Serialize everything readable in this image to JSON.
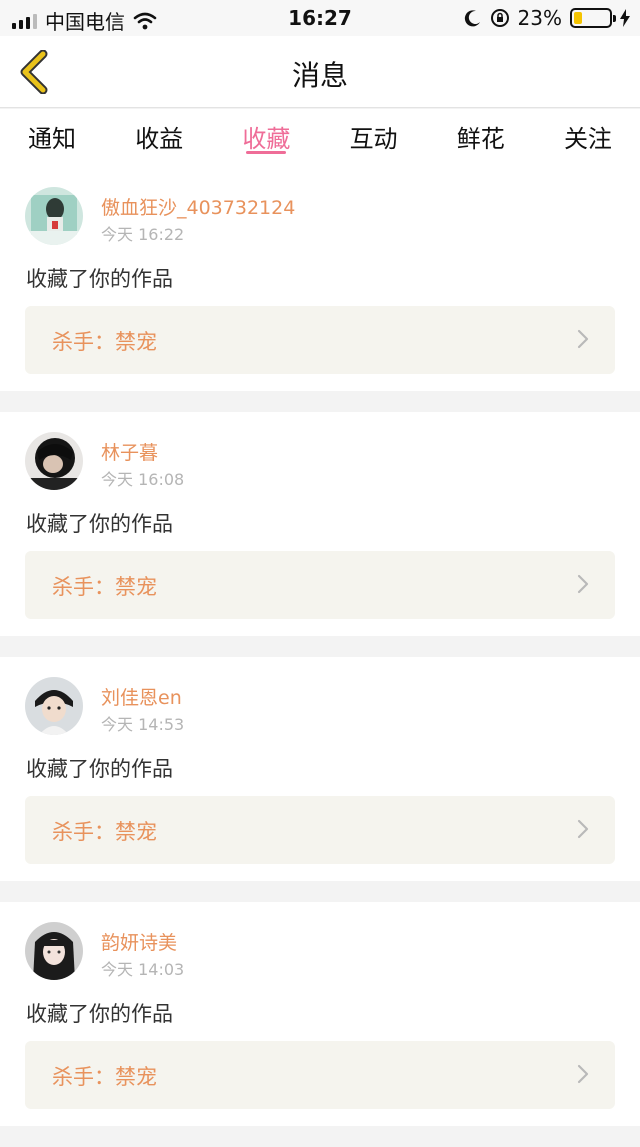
{
  "status_bar": {
    "carrier": "中国电信",
    "time": "16:27",
    "battery_percent": "23%",
    "battery_level": 0.23
  },
  "nav": {
    "title": "消息"
  },
  "tabs": [
    {
      "label": "通知",
      "active": false
    },
    {
      "label": "收益",
      "active": false
    },
    {
      "label": "收藏",
      "active": true
    },
    {
      "label": "互动",
      "active": false
    },
    {
      "label": "鲜花",
      "active": false
    },
    {
      "label": "关注",
      "active": false
    }
  ],
  "messages": [
    {
      "user": "傲血狂沙_403732124",
      "time": "今天 16:22",
      "action": "收藏了你的作品",
      "work": "杀手：禁宠"
    },
    {
      "user": "林子暮",
      "time": "今天 16:08",
      "action": "收藏了你的作品",
      "work": "杀手：禁宠"
    },
    {
      "user": "刘佳恩en",
      "time": "今天 14:53",
      "action": "收藏了你的作品",
      "work": "杀手：禁宠"
    },
    {
      "user": "韵妍诗美",
      "time": "今天 14:03",
      "action": "收藏了你的作品",
      "work": "杀手：禁宠"
    }
  ],
  "colors": {
    "accent_pink": "#ef6d98",
    "name_orange": "#e8925c",
    "back_yellow": "#e9c21a"
  }
}
